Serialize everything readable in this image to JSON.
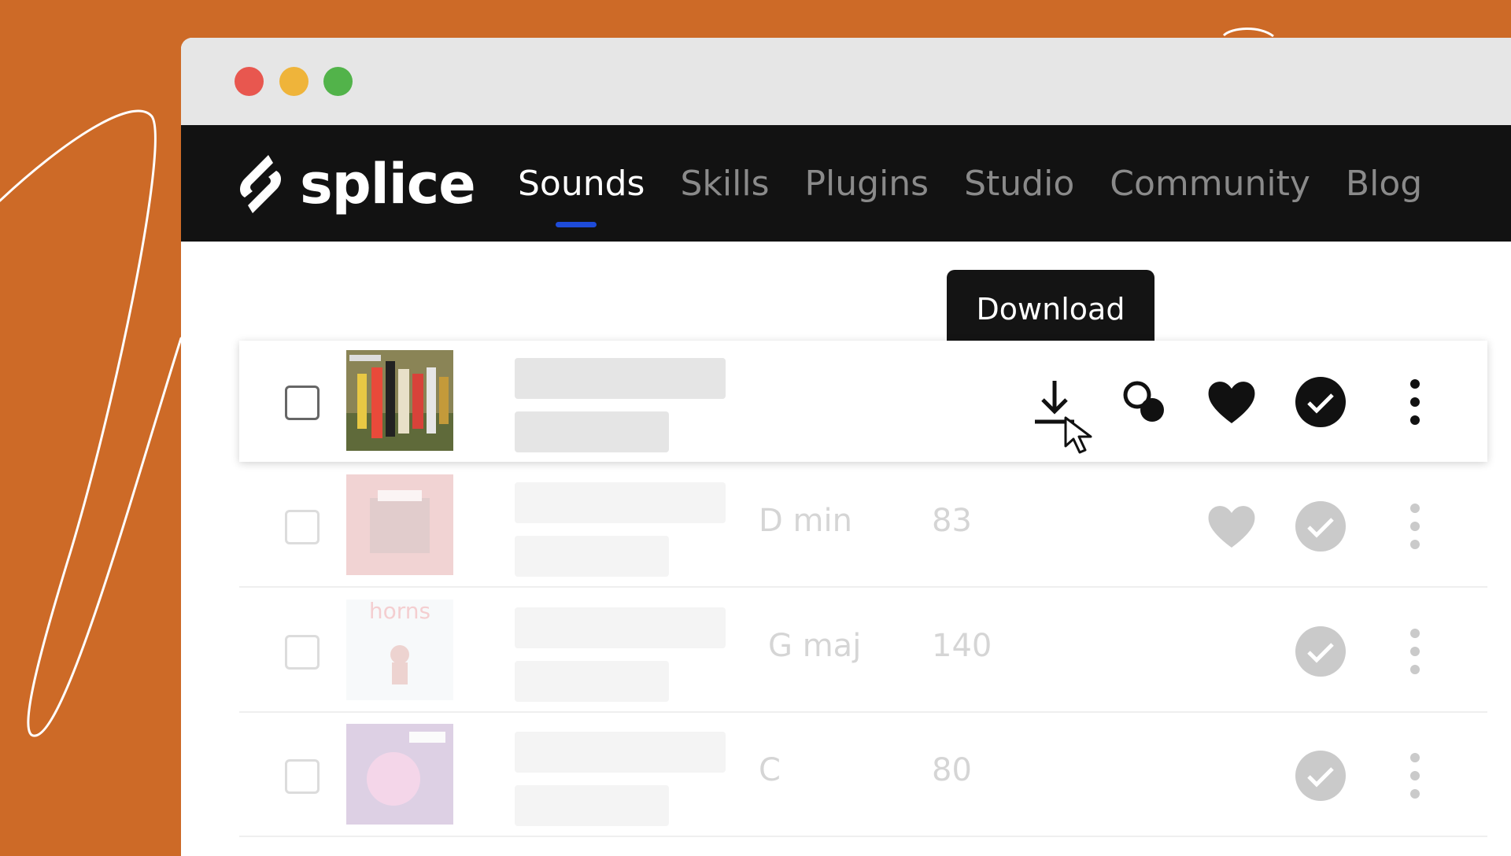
{
  "window": {
    "traffic_lights": [
      "#e8574f",
      "#efb43a",
      "#52b34a"
    ]
  },
  "brand": {
    "name": "splice"
  },
  "nav": {
    "items": [
      {
        "label": "Sounds",
        "active": true
      },
      {
        "label": "Skills",
        "active": false
      },
      {
        "label": "Plugins",
        "active": false
      },
      {
        "label": "Studio",
        "active": false
      },
      {
        "label": "Community",
        "active": false
      },
      {
        "label": "Blog",
        "active": false
      }
    ],
    "accent": "#1e4bd8"
  },
  "tooltip": {
    "text": "Download"
  },
  "rows": [
    {
      "key": "",
      "bpm": "",
      "art": "colorful-abstract-cover",
      "state": "active"
    },
    {
      "key": "D min",
      "bpm": "83",
      "art": "red-cover",
      "state": "faded"
    },
    {
      "key": "G maj",
      "bpm": "140",
      "art": "horns-cover",
      "art_text": "horns",
      "state": "faded"
    },
    {
      "key": "C",
      "bpm": "80",
      "art": "purple-cover",
      "state": "faded"
    }
  ],
  "colors": {
    "background": "#cd6a27",
    "navbar": "#121212",
    "tooltip": "#141414"
  }
}
